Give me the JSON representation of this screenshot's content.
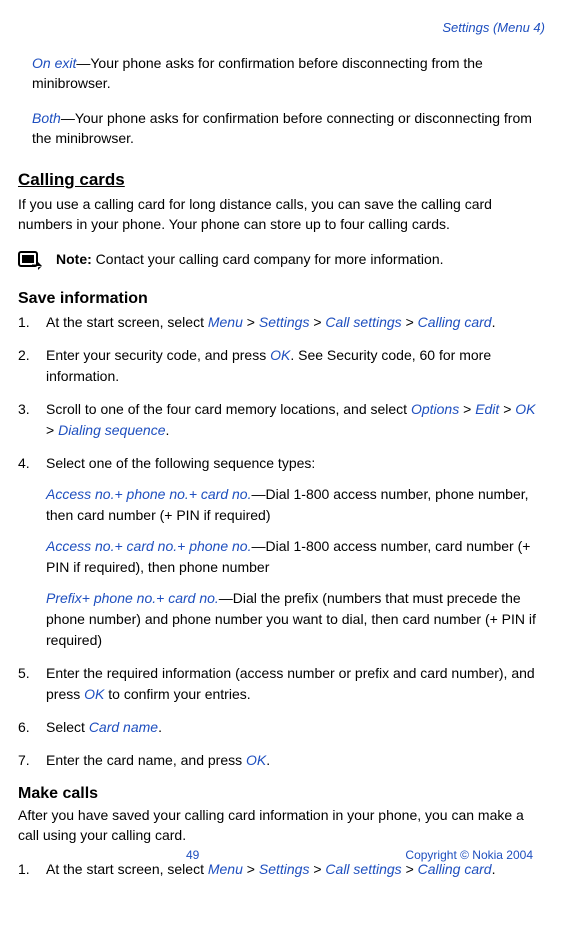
{
  "breadcrumb": "Settings (Menu 4)",
  "intro_options": [
    {
      "term": "On exit",
      "desc": "—Your phone asks for confirmation before disconnecting from the minibrowser."
    },
    {
      "term": "Both",
      "desc": "—Your phone asks for confirmation before connecting or disconnecting from the minibrowser."
    }
  ],
  "h2_calling": "Calling cards",
  "calling_intro": "If you use a calling card for long distance calls, you can save the calling card numbers in your phone. Your phone can store up to four calling cards.",
  "note_label": "Note:",
  "note_text": " Contact your calling card company for more information.",
  "h3_save": "Save information",
  "save_steps": [
    {
      "num": "1.",
      "parts": [
        "At the start screen, select ",
        {
          "link": "Menu"
        },
        " > ",
        {
          "link": "Settings"
        },
        " > ",
        {
          "link": "Call settings"
        },
        " > ",
        {
          "link": "Calling card"
        },
        "."
      ]
    },
    {
      "num": "2.",
      "parts": [
        "Enter your security code, and press ",
        {
          "link": "OK"
        },
        ". See Security code, 60 for more information."
      ]
    },
    {
      "num": "3.",
      "parts": [
        "Scroll to one of the four card memory locations, and select ",
        {
          "link": "Options"
        },
        " > ",
        {
          "link": "Edit"
        },
        " > ",
        {
          "link": "OK"
        },
        " > ",
        {
          "link": "Dialing sequence"
        },
        "."
      ]
    },
    {
      "num": "4.",
      "parts": [
        "Select one of the following sequence types:"
      ],
      "subs": [
        {
          "term": "Access no.+ phone no.+ card no.",
          "desc": "—Dial 1-800 access number, phone number, then card number (+ PIN if required)"
        },
        {
          "term": "Access no.+ card no.+ phone no.",
          "desc": "—Dial 1-800 access number, card number (+ PIN if required), then phone number"
        },
        {
          "term": "Prefix+ phone no.+ card no.",
          "desc": "—Dial the prefix (numbers that must precede the phone number) and phone number you want to dial, then card number (+ PIN if required)"
        }
      ]
    },
    {
      "num": "5.",
      "parts": [
        "Enter the required information (access number or prefix and card number), and press ",
        {
          "link": "OK"
        },
        " to confirm your entries."
      ]
    },
    {
      "num": "6.",
      "parts": [
        "Select ",
        {
          "link": "Card name"
        },
        "."
      ]
    },
    {
      "num": "7.",
      "parts": [
        "Enter the card name, and press ",
        {
          "link": "OK"
        },
        "."
      ]
    }
  ],
  "h3_make": "Make calls",
  "make_intro": "After you have saved your calling card information in your phone, you can make a call using your calling card.",
  "make_steps": [
    {
      "num": "1.",
      "parts": [
        "At the start screen, select ",
        {
          "link": "Menu"
        },
        " > ",
        {
          "link": "Settings"
        },
        " > ",
        {
          "link": "Call settings"
        },
        " > ",
        {
          "link": "Calling card"
        },
        "."
      ]
    }
  ],
  "page_number": "49",
  "copyright": "Copyright © Nokia 2004"
}
